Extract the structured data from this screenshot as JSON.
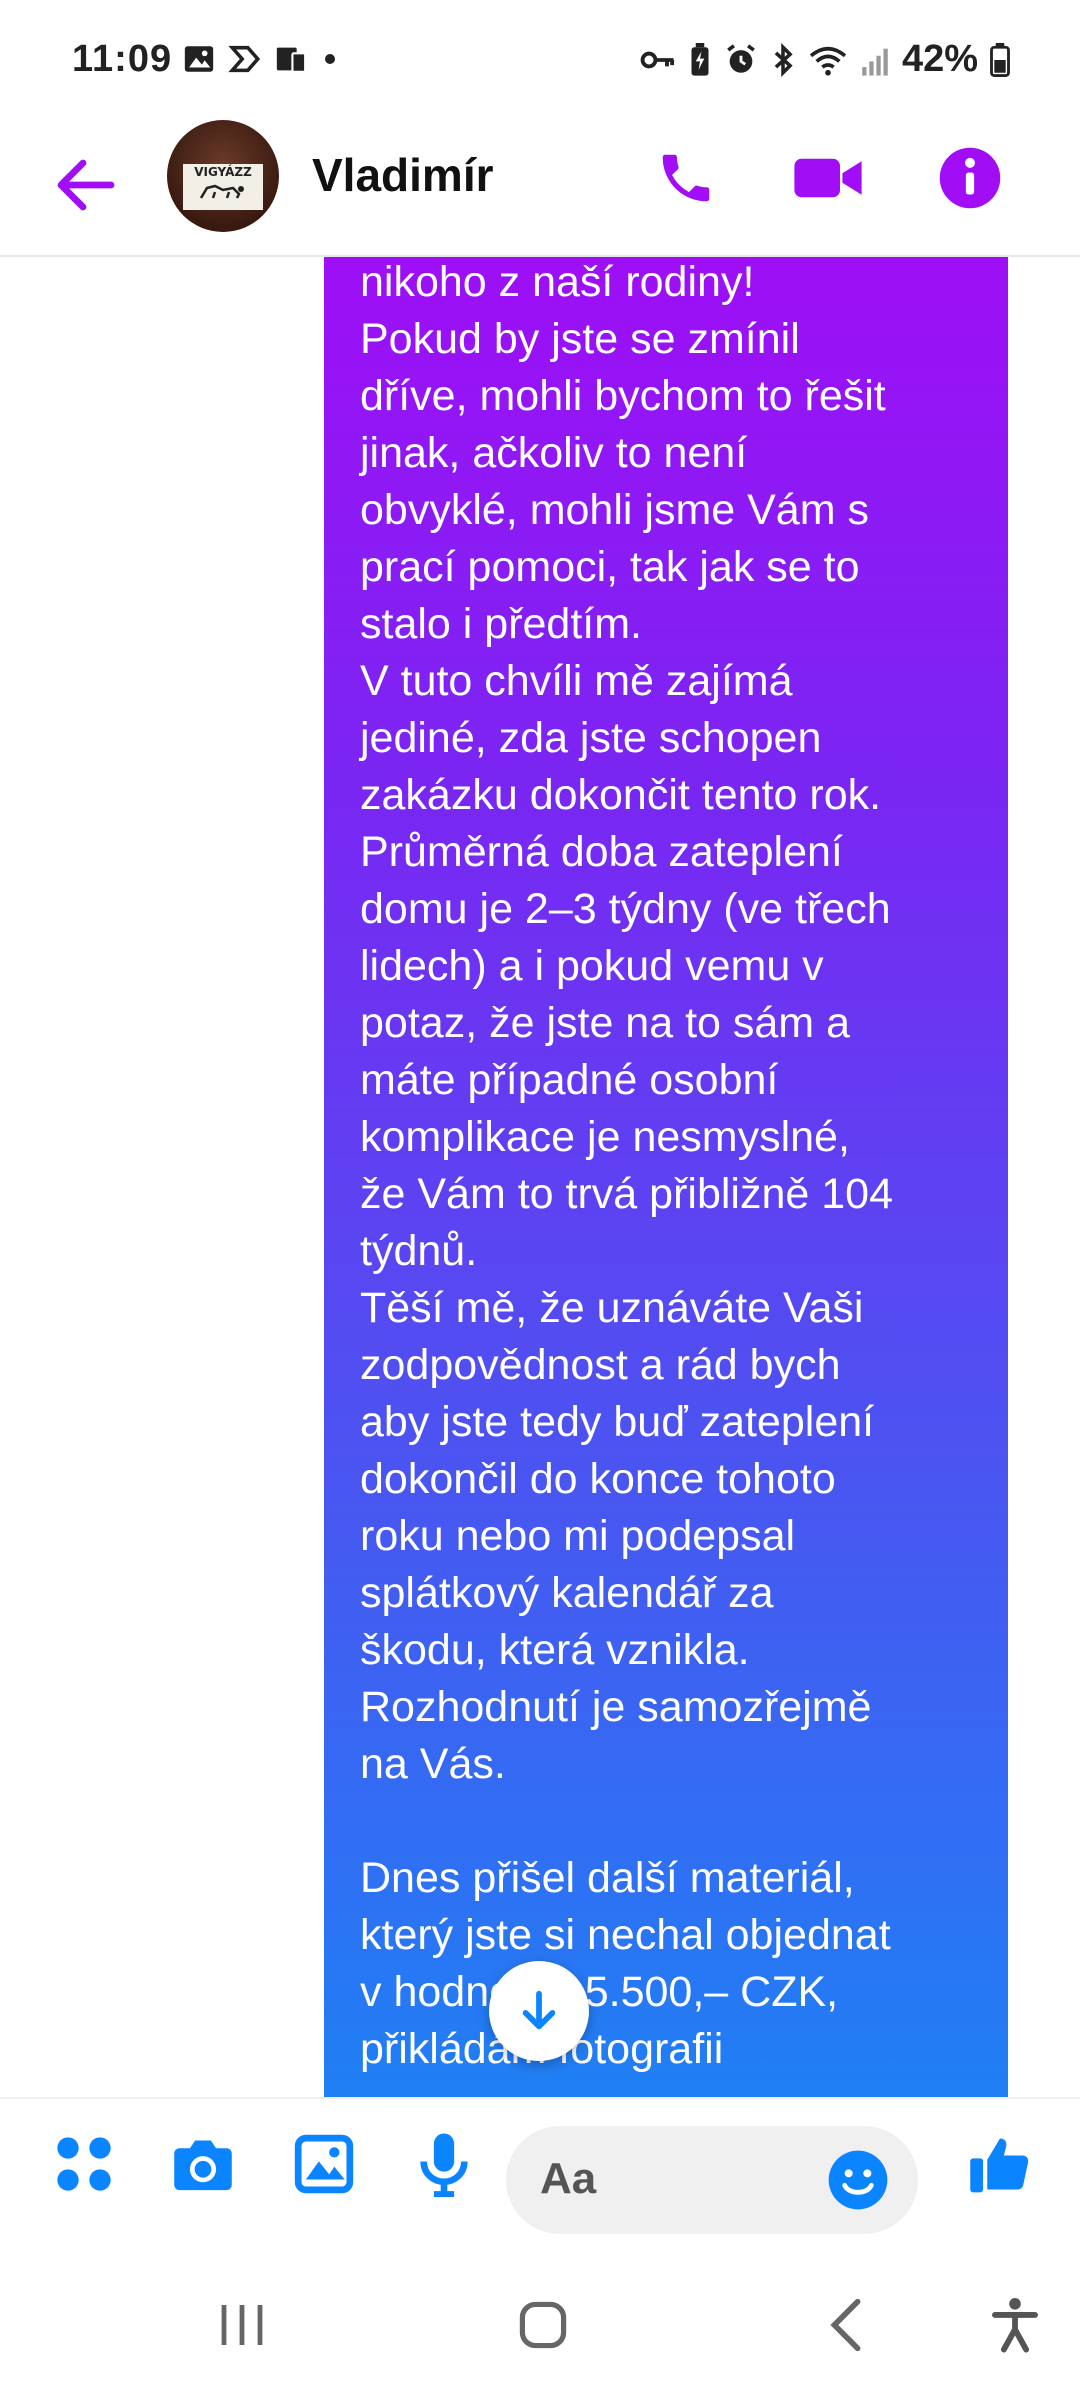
{
  "status_bar": {
    "time": "11:09",
    "battery": "42%"
  },
  "header": {
    "contact_name": "Vladimír",
    "avatar_sign_text": "VIGYÁZZ"
  },
  "message": {
    "text": "není snadná situace. Pro\nnikoho z naší rodiny!\nPokud by jste se zmínil\ndříve, mohli bychom to řešit\njinak, ačkoliv to není\nobvyklé, mohli jsme Vám s\nprací pomoci, tak jak se to\nstalo i předtím.\nV tuto chvíli mě zajímá\njediné, zda jste schopen\nzakázku dokončit tento rok.\nPrůměrná doba zateplení\ndomu je 2–3 týdny (ve třech\nlidech) a i pokud vemu v\npotaz, že jste na to sám a\nmáte případné osobní\nkomplikace je nesmyslné,\nže Vám to trvá přibližně 104\ntýdnů.\nTěší mě, že uznáváte Vaši\nzodpovědnost a rád bych\naby jste tedy buď zateplení\ndokončil do konce tohoto\nroku nebo mi podepsal\nsplátkový kalendář za\nškodu, která vznikla.\nRozhodnutí je samozřejmě\nna Vás.\n\nDnes přišel další materiál,\nkterý jste si nechal objednat\nv hodnotě 15.500,– CZK,\npřikládám fotografii"
  },
  "composer": {
    "placeholder": "Aa"
  },
  "colors": {
    "accent": "#a10df5",
    "icon_blue": "#0a84ff",
    "bubble_top": "#a20cf7",
    "bubble_bottom": "#1b84f5"
  }
}
